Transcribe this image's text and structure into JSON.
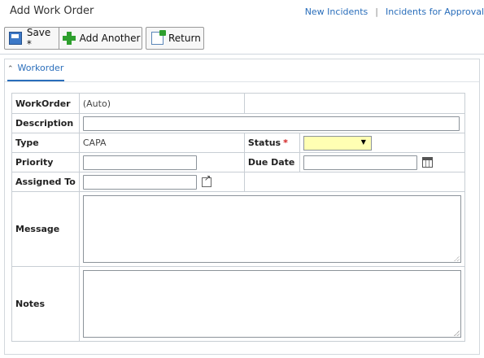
{
  "header": {
    "title": "Add Work Order",
    "links": [
      "New Incidents",
      "Incidents for Approval"
    ],
    "separator": "|"
  },
  "toolbar": {
    "save_label": "Save *",
    "add_another_label": "Add Another",
    "return_label": "Return"
  },
  "tab": {
    "label": "Workorder",
    "icon": "chevron-up-icon"
  },
  "form": {
    "workorder_label": "WorkOrder",
    "workorder_value": "(Auto)",
    "description_label": "Description",
    "description_value": "",
    "type_label": "Type",
    "type_value": "CAPA",
    "status_label": "Status",
    "required_mark": "*",
    "status_value": "",
    "priority_label": "Priority",
    "priority_value": "",
    "due_date_label": "Due Date",
    "due_date_value": "",
    "assigned_to_label": "Assigned To",
    "assigned_to_value": "",
    "message_label": "Message",
    "message_value": "",
    "notes_label": "Notes",
    "notes_value": ""
  },
  "colors": {
    "link": "#2a6ebb",
    "required": "#d21f1f",
    "status_select_bg": "#ffffb3"
  }
}
